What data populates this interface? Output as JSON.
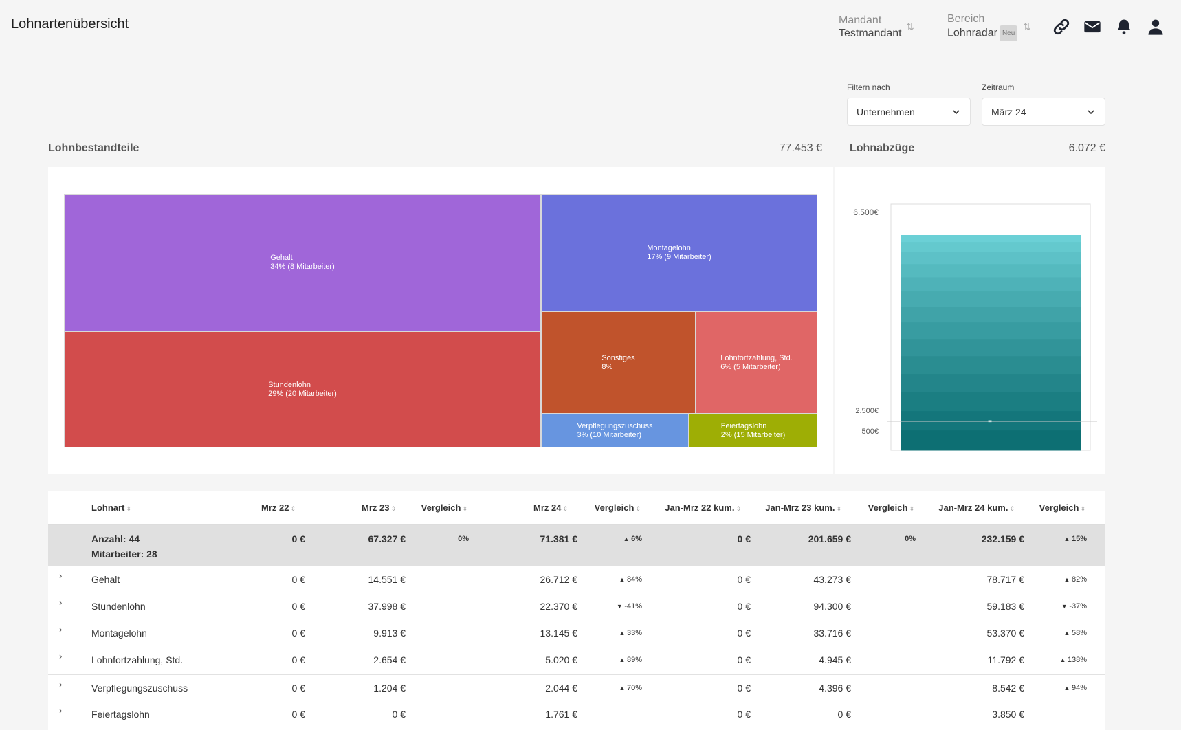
{
  "header": {
    "title": "Lohnartenübersicht",
    "mandant_label": "Mandant",
    "mandant_value": "Testmandant",
    "bereich_label": "Bereich",
    "bereich_value": "Lohnradar",
    "bereich_badge": "Neu",
    "icons": [
      "link-icon",
      "mail-icon",
      "bell-icon",
      "user-icon"
    ]
  },
  "filters": {
    "filter_label": "Filtern nach",
    "filter_value": "Unternehmen",
    "zeitraum_label": "Zeitraum",
    "zeitraum_value": "März 24"
  },
  "bestandteile": {
    "title": "Lohnbestandteile",
    "total": "77.453 €"
  },
  "abzuege": {
    "title": "Lohnabzüge",
    "total": "6.072 €"
  },
  "chart_data": [
    {
      "type": "treemap",
      "items": [
        {
          "name": "Gehalt",
          "label": "34% (8 Mitarbeiter)",
          "share": 34,
          "color": "#a066d9"
        },
        {
          "name": "Stundenlohn",
          "label": "29% (20 Mitarbeiter)",
          "share": 29,
          "color": "#d24c4c"
        },
        {
          "name": "Montagelohn",
          "label": "17% (9 Mitarbeiter)",
          "share": 17,
          "color": "#6b71dc"
        },
        {
          "name": "Sonstiges",
          "label": "8%",
          "share": 8,
          "color": "#c0532c"
        },
        {
          "name": "Lohnfortzahlung, Std.",
          "label": "6% (5 Mitarbeiter)",
          "share": 6,
          "color": "#e06666"
        },
        {
          "name": "Verpflegungszuschuss",
          "label": "3% (10 Mitarbeiter)",
          "share": 3,
          "color": "#6795e0"
        },
        {
          "name": "Feiertagslohn",
          "label": "2% (15 Mitarbeiter)",
          "share": 2,
          "color": "#9eae05"
        }
      ]
    },
    {
      "type": "bar",
      "ticks": [
        "6.500€",
        "2.500€",
        "500€"
      ],
      "tick_values": [
        6500,
        2500,
        500
      ],
      "value": 6072,
      "color_top": "#6bd0d6",
      "color_bottom": "#0d6f73"
    }
  ],
  "table": {
    "headers": [
      "Lohnart",
      "Mrz 22",
      "Mrz 23",
      "Vergleich",
      "Mrz 24",
      "Vergleich",
      "Jan-Mrz 22 kum.",
      "Jan-Mrz 23 kum.",
      "Vergleich",
      "Jan-Mrz 24 kum.",
      "Vergleich"
    ],
    "summary": {
      "count": "Anzahl: 44",
      "employees": "Mitarbeiter: 28",
      "values": [
        "0 €",
        "67.327 €",
        "0%",
        "71.381 €",
        "6%",
        "0 €",
        "201.659 €",
        "0%",
        "232.159 €",
        "15%"
      ],
      "trends": [
        "",
        "",
        "",
        "",
        "up",
        "",
        "",
        "",
        "",
        "up"
      ]
    },
    "rows": [
      {
        "name": "Gehalt",
        "values": [
          "0 €",
          "14.551 €",
          "",
          "26.712 €",
          "84%",
          "0 €",
          "43.273 €",
          "",
          "78.717 €",
          "82%"
        ],
        "trends": [
          "",
          "",
          "",
          "",
          "up",
          "",
          "",
          "",
          "",
          "up"
        ]
      },
      {
        "name": "Stundenlohn",
        "values": [
          "0 €",
          "37.998 €",
          "",
          "22.370 €",
          "-41%",
          "0 €",
          "94.300 €",
          "",
          "59.183 €",
          "-37%"
        ],
        "trends": [
          "",
          "",
          "",
          "",
          "down",
          "",
          "",
          "",
          "",
          "down"
        ]
      },
      {
        "name": "Montagelohn",
        "values": [
          "0 €",
          "9.913 €",
          "",
          "13.145 €",
          "33%",
          "0 €",
          "33.716 €",
          "",
          "53.370 €",
          "58%"
        ],
        "trends": [
          "",
          "",
          "",
          "",
          "up",
          "",
          "",
          "",
          "",
          "up"
        ]
      },
      {
        "name": "Lohnfortzahlung, Std.",
        "values": [
          "0 €",
          "2.654 €",
          "",
          "5.020 €",
          "89%",
          "0 €",
          "4.945 €",
          "",
          "11.792 €",
          "138%"
        ],
        "trends": [
          "",
          "",
          "",
          "",
          "up",
          "",
          "",
          "",
          "",
          "up"
        ]
      },
      {
        "name": "Verpflegungszuschuss",
        "values": [
          "0 €",
          "1.204 €",
          "",
          "2.044 €",
          "70%",
          "0 €",
          "4.396 €",
          "",
          "8.542 €",
          "94%"
        ],
        "trends": [
          "",
          "",
          "",
          "",
          "up",
          "",
          "",
          "",
          "",
          "up"
        ]
      },
      {
        "name": "Feiertagslohn",
        "values": [
          "0 €",
          "0 €",
          "",
          "1.761 €",
          "",
          "0 €",
          "0 €",
          "",
          "3.850 €",
          ""
        ],
        "trends": [
          "",
          "",
          "",
          "",
          "",
          "",
          "",
          "",
          "",
          ""
        ]
      }
    ]
  }
}
